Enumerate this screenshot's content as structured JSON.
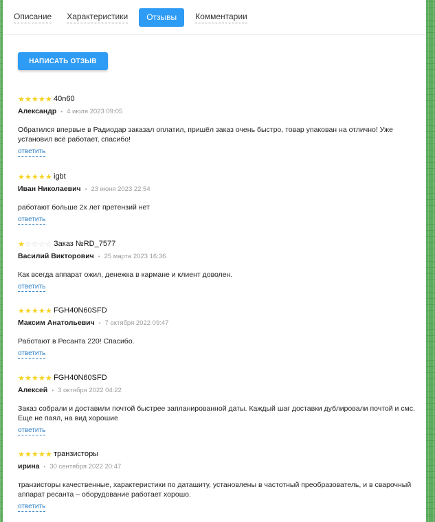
{
  "tabs": [
    {
      "label": "Описание"
    },
    {
      "label": "Характеристики"
    },
    {
      "label": "Отзывы"
    },
    {
      "label": "Комментарии"
    }
  ],
  "write_button": "НАПИСАТЬ ОТЗЫВ",
  "reviews": [
    {
      "stars": 5,
      "title": "40n60",
      "author": "Александр",
      "date": "4 июля 2023 09:05",
      "text": "Обратился впервые в Радиодар заказал оплатил, пришёл заказ очень быстро, товар упакован на отлично! Уже установил всё работает, спасибо!",
      "reply": "ответить"
    },
    {
      "stars": 5,
      "title": "igbt",
      "author": "Иван Николаевич",
      "date": "23 июня 2023 22:54",
      "text": "работают больше 2х лет претензий нет",
      "reply": "ответить"
    },
    {
      "stars": 1,
      "title": "Заказ №RD_7577",
      "author": "Василий Викторович",
      "date": "25 марта 2023 16:36",
      "text": "Как всегда аппарат ожил, денежка в кармане и клиент доволен.",
      "reply": "ответить"
    },
    {
      "stars": 5,
      "title": "FGH40N60SFD",
      "author": "Максим Анатольевич",
      "date": "7 октября 2022 09:47",
      "text": "Работают в Ресанта 220! Спасибо.",
      "reply": "ответить"
    },
    {
      "stars": 5,
      "title": "FGH40N60SFD",
      "author": "Алексей",
      "date": "3 октября 2022 04:22",
      "text": "Заказ собрали и доставили почтой быстрее запланированной даты. Каждый шаг доставки дублировали почтой и смс. Еще не паял, на вид хорошие",
      "reply": "ответить"
    },
    {
      "stars": 5,
      "title": "транзисторы",
      "author": "ирина",
      "date": "30 сентября 2022 20:47",
      "text": "транзисторы качественные, характеристики по даташиту, установлены в частотный преобразователь, и в сварочный аппарат ресанта – оборудование работает хорошо.",
      "reply": "ответить"
    }
  ]
}
